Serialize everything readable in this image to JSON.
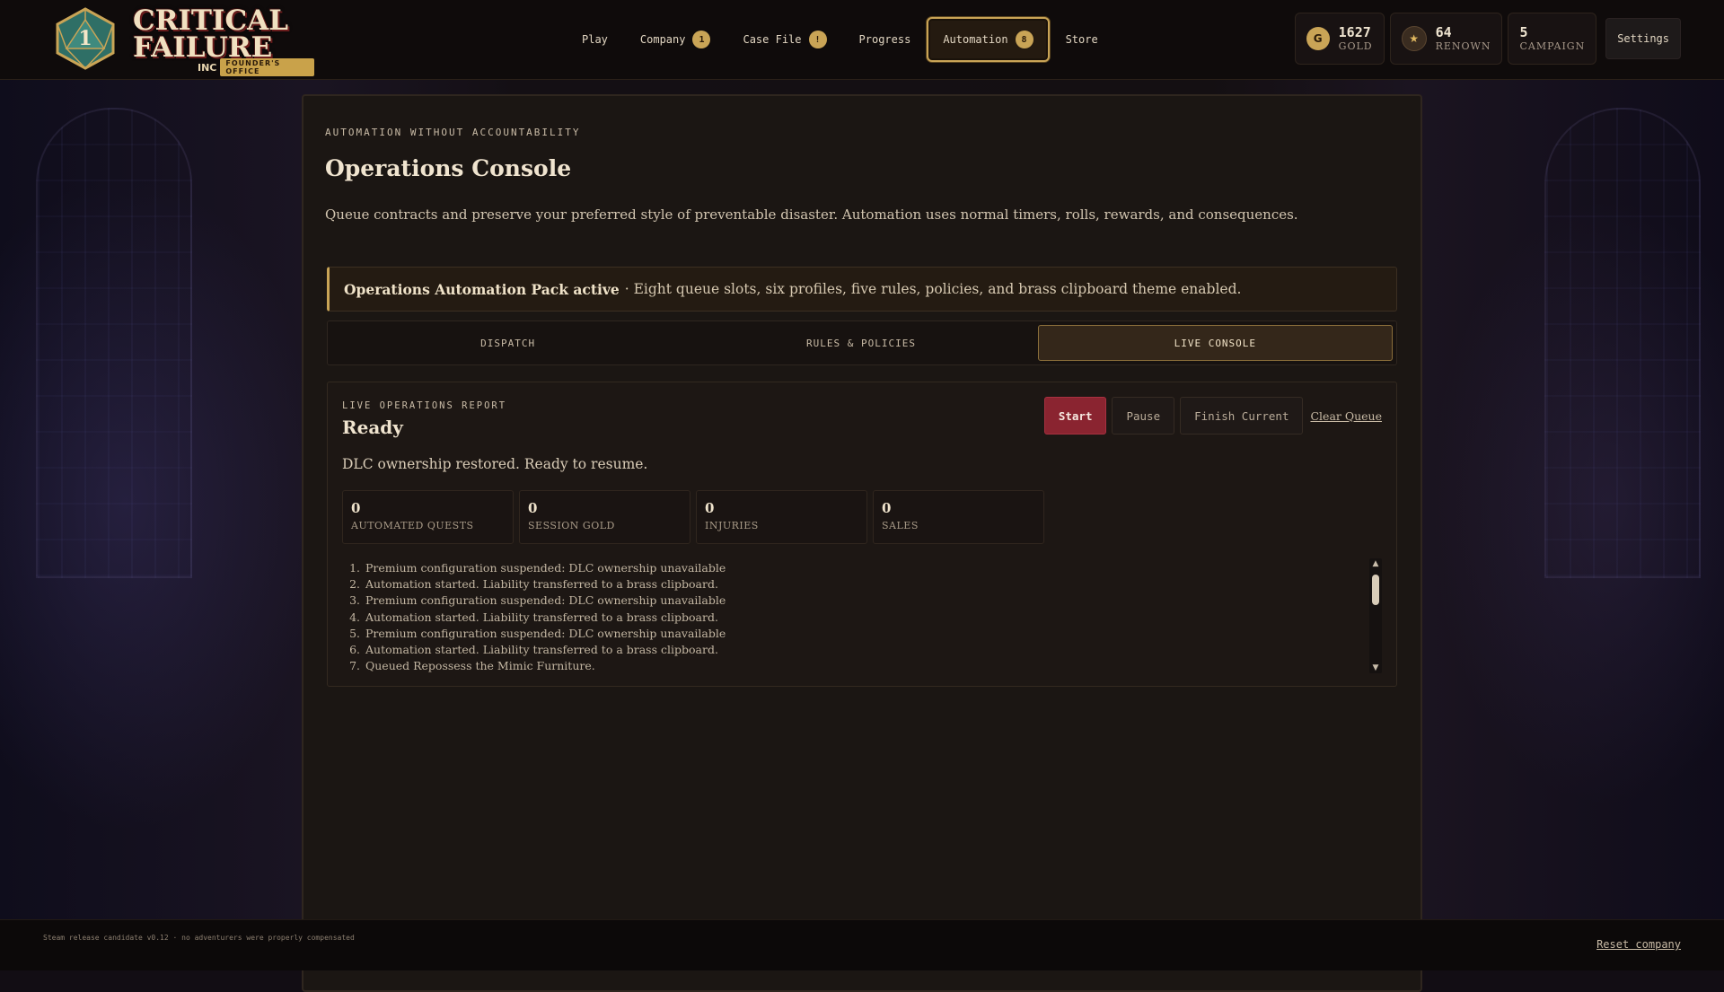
{
  "brand": {
    "d20_number": "1",
    "title_line1": "CRITICAL",
    "title_line2": "FAILURE",
    "inc": "INC",
    "office_label": "FOUNDER'S OFFICE"
  },
  "nav": [
    {
      "label": "Play",
      "badge": null
    },
    {
      "label": "Company",
      "badge": "1"
    },
    {
      "label": "Case File",
      "badge": "!"
    },
    {
      "label": "Progress",
      "badge": null
    },
    {
      "label": "Automation",
      "badge": "8",
      "active": true
    },
    {
      "label": "Store",
      "badge": null
    }
  ],
  "stats": {
    "gold": {
      "icon_letter": "G",
      "value": "1627",
      "label": "GOLD"
    },
    "renown": {
      "icon": "star-icon",
      "glyph": "★",
      "value": "64",
      "label": "RENOWN"
    },
    "campaign": {
      "value": "5",
      "label": "CAMPAIGN"
    },
    "settings_label": "Settings"
  },
  "page": {
    "eyebrow": "AUTOMATION WITHOUT ACCOUNTABILITY",
    "title": "Operations Console",
    "description": "Queue contracts and preserve your preferred style of preventable disaster. Automation uses normal timers, rolls, rewards, and consequences."
  },
  "banner": {
    "strong": "Operations Automation Pack active",
    "text": "· Eight queue slots, six profiles, five rules, policies, and brass clipboard theme enabled."
  },
  "tabs": [
    {
      "label": "DISPATCH"
    },
    {
      "label": "RULES & POLICIES"
    },
    {
      "label": "LIVE CONSOLE",
      "active": true
    }
  ],
  "report": {
    "eyebrow": "LIVE OPERATIONS REPORT",
    "status": "Ready",
    "message": "DLC ownership restored. Ready to resume.",
    "controls": {
      "start": "Start",
      "pause": "Pause",
      "finish": "Finish Current",
      "clear": "Clear Queue"
    },
    "metrics": [
      {
        "value": "0",
        "label": "AUTOMATED QUESTS"
      },
      {
        "value": "0",
        "label": "SESSION GOLD"
      },
      {
        "value": "0",
        "label": "INJURIES"
      },
      {
        "value": "0",
        "label": "SALES"
      }
    ],
    "log": [
      "Premium configuration suspended: DLC ownership unavailable",
      "Automation started. Liability transferred to a brass clipboard.",
      "Premium configuration suspended: DLC ownership unavailable",
      "Automation started. Liability transferred to a brass clipboard.",
      "Premium configuration suspended: DLC ownership unavailable",
      "Automation started. Liability transferred to a brass clipboard.",
      "Queued Repossess the Mimic Furniture."
    ],
    "scroll": {
      "up_glyph": "▲",
      "down_glyph": "▼"
    }
  },
  "footer": {
    "note": "Steam release candidate v0.12 · no adventurers were properly compensated",
    "reset": "Reset company"
  },
  "colors": {
    "accent_gold": "#c9a456",
    "start_red": "#8a2430",
    "panel_bg": "#1b1613"
  }
}
